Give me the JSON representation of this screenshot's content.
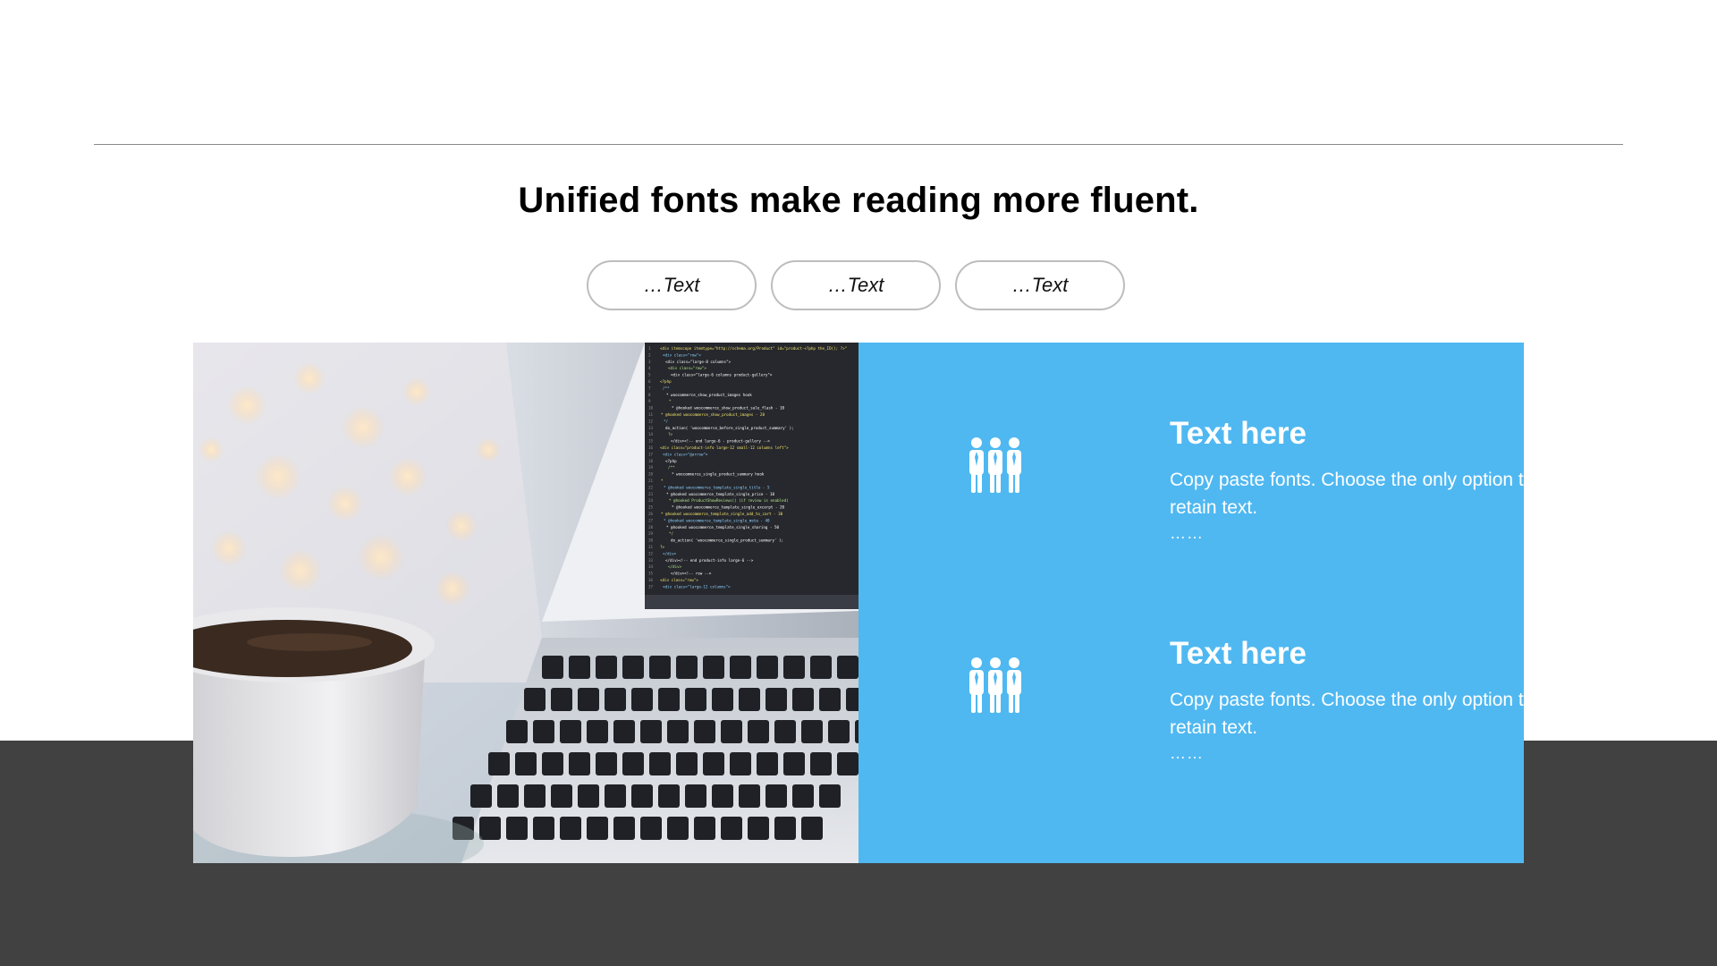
{
  "headline": "Unified fonts make reading more fluent.",
  "pills": [
    {
      "label": "…Text"
    },
    {
      "label": "…Text"
    },
    {
      "label": "…Text"
    }
  ],
  "features": [
    {
      "title": "Text here",
      "description": "Copy paste fonts. Choose the only option to retain text.",
      "more": "……",
      "icon": "team-icon"
    },
    {
      "title": "Text here",
      "description": "Copy paste fonts. Choose the only option to retain text.",
      "more": "……",
      "icon": "team-icon"
    }
  ],
  "colors": {
    "accent": "#4fb8f1",
    "dark_band": "#414141",
    "rule": "#8a8a8a",
    "pill_border": "#bdbdbd"
  },
  "photo": {
    "icon": "laptop-coffee-photo",
    "code_lines": [
      "<div itemscope itemtype=\"http://schema.org/Product\" id=\"product-<?php the_ID(); ?>\"",
      "<div class=\"row\">",
      "<div class=\"large-8 columns\">",
      "<div class=\"row\">",
      "<div class=\"large-6 columns product-gallery\">",
      "<?php",
      "/**",
      " * woocommerce_show_product_images hook",
      " *",
      " * @hooked woocommerce_show_product_sale_flash - 10",
      " * @hooked woocommerce_show_product_images - 20",
      " */",
      "do_action( 'woocommerce_before_single_product_summary' );",
      "?>",
      "</div><!-- end large-6 - product-gallery -->",
      "<div class=\"product-info large-12 small-12 columns left\">",
      "<div class=\"@arrow\">",
      "<?php",
      "/**",
      " * woocommerce_single_product_summary hook",
      " *",
      " * @hooked woocommerce_template_single_title - 5",
      " * @hooked woocommerce_template_single_price - 10",
      " * @hooked ProductShowReviews() (if review is enabled)",
      " * @hooked woocommerce_template_single_excerpt - 20",
      " * @hooked woocommerce_template_single_add_to_cart - 30",
      " * @hooked woocommerce_template_single_meta - 40",
      " * @hooked woocommerce_template_single_sharing - 50",
      " */",
      "do_action( 'woocommerce_single_product_summary' );",
      "?>",
      "</div>",
      "</div><!-- end product-info large-6 -->",
      "</div>",
      "</div><!-- row -->",
      "<div class=\"row\">",
      "<div class=\"large-12 columns\">"
    ]
  }
}
